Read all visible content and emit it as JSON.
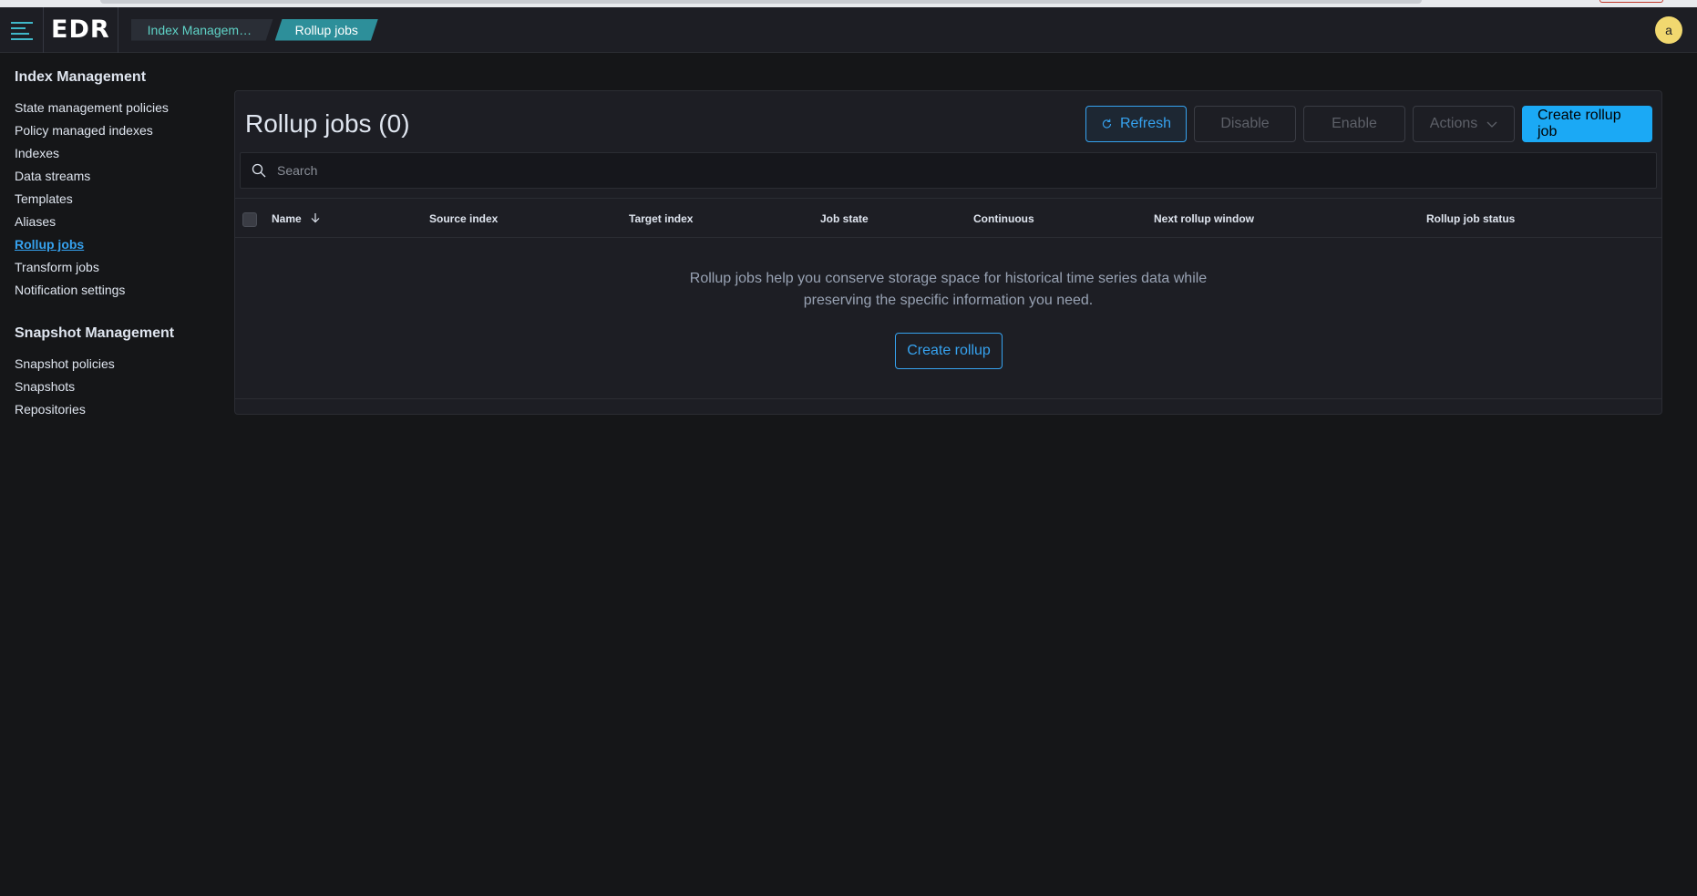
{
  "header": {
    "logo_text": "EDR",
    "breadcrumbs": [
      "Index Manageme...",
      "Rollup jobs"
    ],
    "avatar_initial": "a"
  },
  "sidebar": {
    "group1": {
      "heading": "Index Management",
      "items": [
        "State management policies",
        "Policy managed indexes",
        "Indexes",
        "Data streams",
        "Templates",
        "Aliases",
        "Rollup jobs",
        "Transform jobs",
        "Notification settings"
      ],
      "active": "Rollup jobs"
    },
    "group2": {
      "heading": "Snapshot Management",
      "items": [
        "Snapshot policies",
        "Snapshots",
        "Repositories"
      ]
    }
  },
  "main": {
    "title": "Rollup jobs (0)",
    "toolbar": {
      "refresh": "Refresh",
      "disable": "Disable",
      "enable": "Enable",
      "actions": "Actions",
      "create": "Create rollup job"
    },
    "search": {
      "placeholder": "Search",
      "value": ""
    },
    "columns": [
      "Name",
      "Source index",
      "Target index",
      "Job state",
      "Continuous",
      "Next rollup window",
      "Rollup job status"
    ],
    "sorted_column": "Name",
    "sort_direction": "descending",
    "empty_message_line1": "Rollup jobs help you conserve storage space for historical time series data while",
    "empty_message_line2": "preserving the specific information you need.",
    "empty_action": "Create rollup"
  },
  "colors": {
    "accent": "#36a2ef",
    "primary_button": "#1ba9f5",
    "breadcrumb_active": "#2d8f9a",
    "avatar": "#f1d86f",
    "background": "#151618",
    "panel": "#1d1e24"
  }
}
